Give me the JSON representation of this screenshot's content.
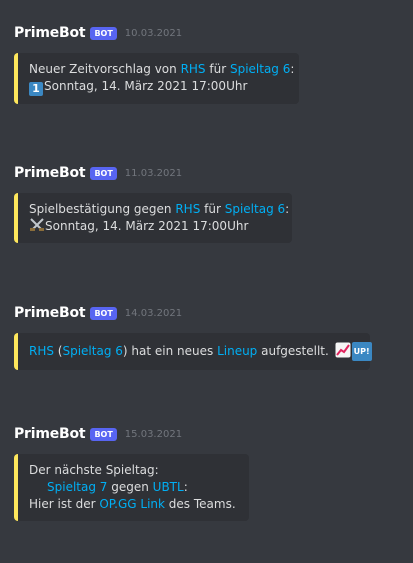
{
  "messages": [
    {
      "author": "PrimeBot",
      "badge": "BOT",
      "timestamp": "10.03.2021",
      "text1": "Neuer Zeitvorschlag von ",
      "team": "RHS",
      "text2": " für ",
      "matchday": "Spieltag 6",
      "text3": ":",
      "emoji": "keycap-1",
      "date_text": "Sonntag, 14. März 2021 17:00Uhr"
    },
    {
      "author": "PrimeBot",
      "badge": "BOT",
      "timestamp": "11.03.2021",
      "text1": "Spielbestätigung gegen ",
      "team": "RHS",
      "text2": " für ",
      "matchday": "Spieltag 6",
      "text3": ":",
      "emoji": "crossed-swords",
      "date_text": "Sonntag, 14. März 2021 17:00Uhr"
    },
    {
      "author": "PrimeBot",
      "badge": "BOT",
      "timestamp": "14.03.2021",
      "team": "RHS",
      "paren_open": " (",
      "matchday": "Spieltag 6",
      "text1": ") hat ein neues ",
      "lineup_link": "Lineup",
      "text2": " aufgestellt.",
      "emoji1": "chart-increasing",
      "emoji2": "UP!"
    },
    {
      "author": "PrimeBot",
      "badge": "BOT",
      "timestamp": "15.03.2021",
      "line1": "Der nächste Spieltag:",
      "matchday": "Spieltag 7",
      "text_against": " gegen ",
      "opponent": "UBTL",
      "colon": ":",
      "line3_a": "Hier ist der ",
      "opgg_link": "OP.GG Link",
      "line3_b": " des Teams."
    }
  ],
  "colors": {
    "background": "#36393f",
    "embed": "#2f3136",
    "accent": "#fee75c",
    "link": "#00aff4",
    "badge": "#5865f2"
  }
}
